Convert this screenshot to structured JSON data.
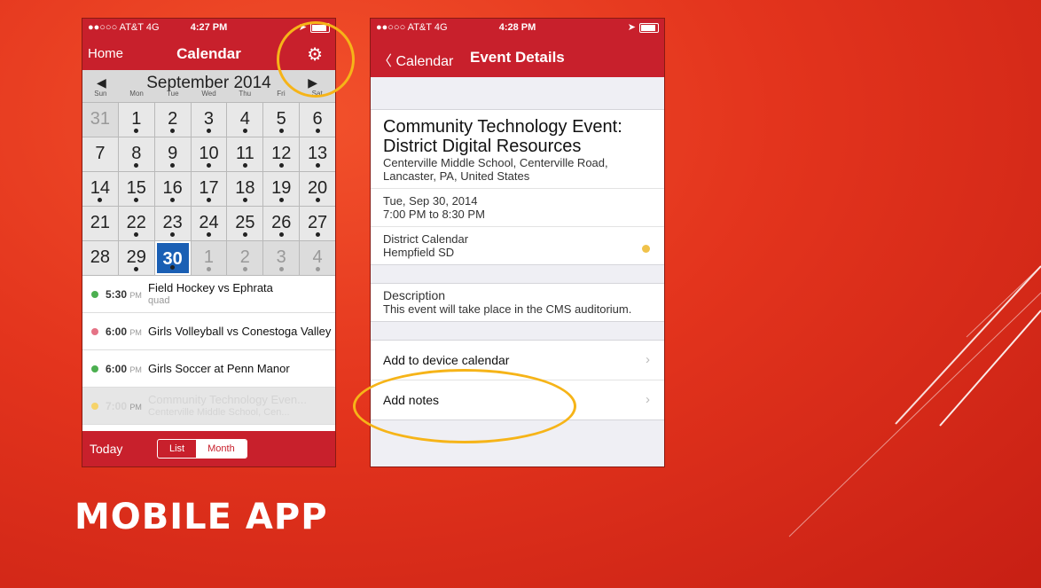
{
  "slide": {
    "title": "MOBILE APP"
  },
  "phone1": {
    "status": {
      "carrier": "●●○○○ AT&T 4G",
      "time": "4:27 PM"
    },
    "nav": {
      "left": "Home",
      "title": "Calendar",
      "settings_icon": "gear-icon"
    },
    "month": {
      "title": "September 2014",
      "prev": "◀",
      "next": "▶",
      "weekdays": [
        "Sun",
        "Mon",
        "Tue",
        "Wed",
        "Thu",
        "Fri",
        "Sat"
      ]
    },
    "days": [
      {
        "d": "31",
        "m": true,
        "dot": false
      },
      {
        "d": "1",
        "dot": true
      },
      {
        "d": "2",
        "dot": true
      },
      {
        "d": "3",
        "dot": true
      },
      {
        "d": "4",
        "dot": true
      },
      {
        "d": "5",
        "dot": true
      },
      {
        "d": "6",
        "dot": true
      },
      {
        "d": "7",
        "dot": false
      },
      {
        "d": "8",
        "dot": true
      },
      {
        "d": "9",
        "dot": true
      },
      {
        "d": "10",
        "dot": true
      },
      {
        "d": "11",
        "dot": true
      },
      {
        "d": "12",
        "dot": true
      },
      {
        "d": "13",
        "dot": true
      },
      {
        "d": "14",
        "dot": true
      },
      {
        "d": "15",
        "dot": true
      },
      {
        "d": "16",
        "dot": true
      },
      {
        "d": "17",
        "dot": true
      },
      {
        "d": "18",
        "dot": true
      },
      {
        "d": "19",
        "dot": true
      },
      {
        "d": "20",
        "dot": true
      },
      {
        "d": "21",
        "dot": false
      },
      {
        "d": "22",
        "dot": true
      },
      {
        "d": "23",
        "dot": true
      },
      {
        "d": "24",
        "dot": true
      },
      {
        "d": "25",
        "dot": true
      },
      {
        "d": "26",
        "dot": true
      },
      {
        "d": "27",
        "dot": true
      },
      {
        "d": "28",
        "dot": false
      },
      {
        "d": "29",
        "dot": true
      },
      {
        "d": "30",
        "sel": true,
        "dot": true
      },
      {
        "d": "1",
        "m": true,
        "dot": true
      },
      {
        "d": "2",
        "m": true,
        "dot": true
      },
      {
        "d": "3",
        "m": true,
        "dot": true
      },
      {
        "d": "4",
        "m": true,
        "dot": true
      }
    ],
    "events": [
      {
        "time": "5:30",
        "ampm": "PM",
        "title": "Field Hockey vs Ephrata",
        "sub": "quad",
        "color": "#4caf50"
      },
      {
        "time": "6:00",
        "ampm": "PM",
        "title": "Girls Volleyball vs Conestoga Valley",
        "sub": "",
        "color": "#e57386"
      },
      {
        "time": "6:00",
        "ampm": "PM",
        "title": "Girls Soccer at Penn Manor",
        "sub": "",
        "color": "#4caf50"
      },
      {
        "time": "7:00",
        "ampm": "PM",
        "title": "Community Technology Even...",
        "sub": "Centerville Middle School, Cen...",
        "color": "#f6d36a",
        "faded": true
      }
    ],
    "tabbar": {
      "today": "Today",
      "list": "List",
      "month": "Month"
    }
  },
  "phone2": {
    "status": {
      "carrier": "●●○○○ AT&T 4G",
      "time": "4:28 PM"
    },
    "nav": {
      "back": "〈 Calendar",
      "title": "Event Details"
    },
    "event": {
      "title": "Community Technology Event: District Digital Resources",
      "location": "Centerville Middle School, Centerville Road, Lancaster, PA, United States",
      "date": "Tue, Sep 30, 2014",
      "time": "7:00 PM to 8:30 PM",
      "calendar": "District Calendar",
      "calendar_owner": "Hempfield SD",
      "calendar_color": "#f0c24a"
    },
    "description": {
      "label": "Description",
      "text": "This event will take place in the CMS auditorium."
    },
    "actions": {
      "add_calendar": "Add to device calendar",
      "add_notes": "Add notes",
      "chevron": "›"
    }
  },
  "colors": {
    "app_red": "#c8202c",
    "highlight": "#f6b418",
    "selected_day": "#1a5fb4"
  }
}
